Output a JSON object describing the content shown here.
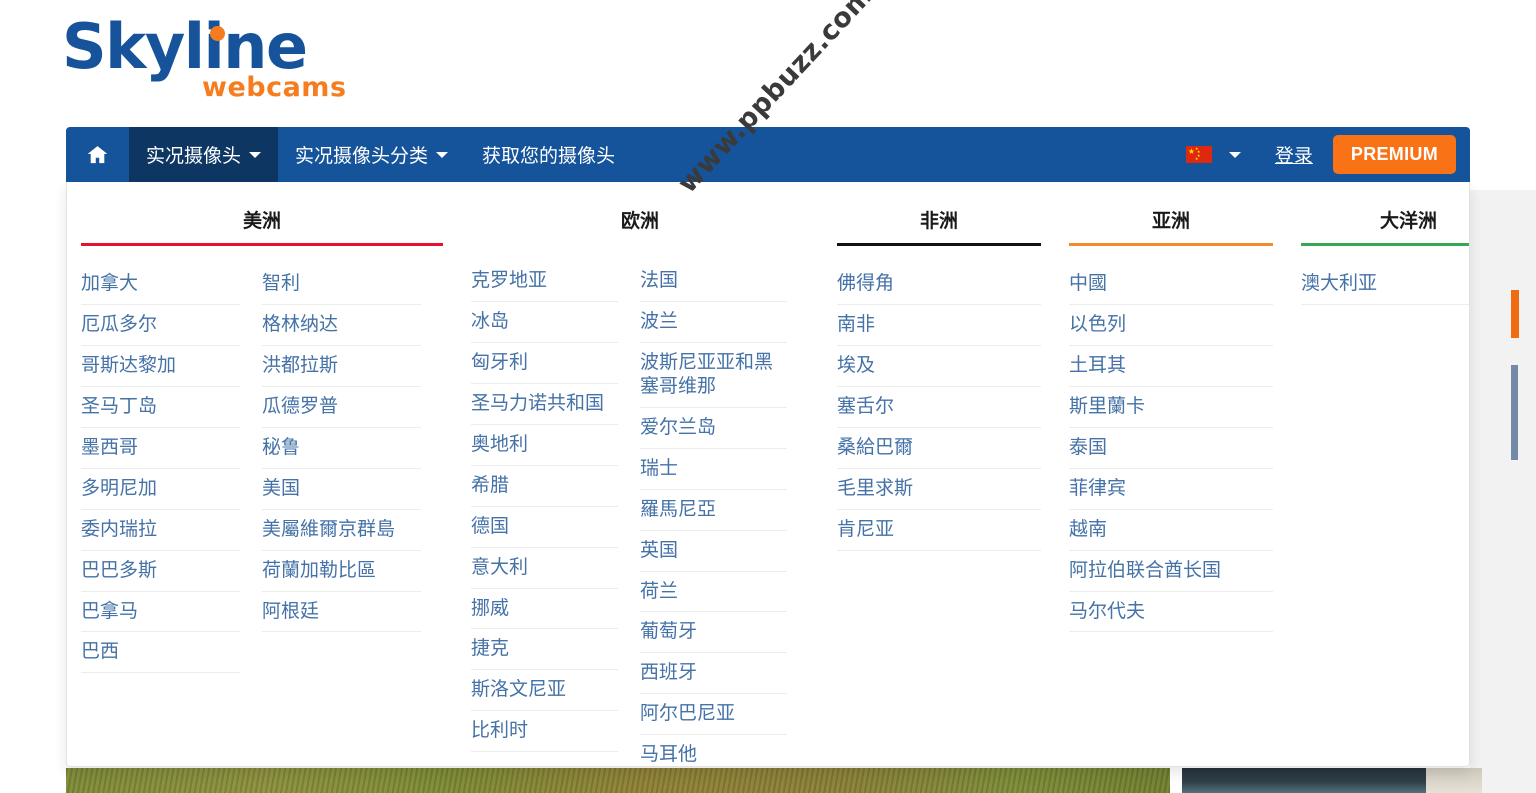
{
  "brand": {
    "name": "Skyline",
    "subtitle": "webcams"
  },
  "navbar": {
    "home_icon": "home-icon",
    "items": [
      {
        "label": "实况摄像头",
        "has_caret": true,
        "active": true
      },
      {
        "label": "实况摄像头分类",
        "has_caret": true,
        "active": false
      },
      {
        "label": "获取您的摄像头",
        "has_caret": false,
        "active": false
      }
    ],
    "language": {
      "flag": "cn-flag-icon",
      "caret": "chevron-down-icon"
    },
    "login_label": "登录",
    "premium_label": "PREMIUM",
    "bg_color": "#15539b",
    "active_bg_color": "#0d3663",
    "premium_color": "#f97316"
  },
  "watermark": "www.ppbuzz.com",
  "dropdown": {
    "regions": [
      {
        "title": "美洲",
        "rule_color": "#e8112d",
        "columns": [
          [
            "加拿大",
            "厄瓜多尔",
            "哥斯达黎加",
            "圣马丁岛",
            "墨西哥",
            "多明尼加",
            "委内瑞拉",
            "巴巴多斯",
            "巴拿马",
            "巴西"
          ],
          [
            "智利",
            "格林纳达",
            "洪都拉斯",
            "瓜德罗普",
            "秘鲁",
            "美国",
            "美屬維爾京群島",
            "荷蘭加勒比區",
            "阿根廷"
          ]
        ]
      },
      {
        "title": "欧洲",
        "rule_color": "#1a8cd8",
        "columns": [
          [
            "克罗地亚",
            "冰岛",
            "匈牙利",
            "圣马力诺共和国",
            "奥地利",
            "希腊",
            "德国",
            "意大利",
            "挪威",
            "捷克",
            "斯洛文尼亚",
            "比利时"
          ],
          [
            "法国",
            "波兰",
            "波斯尼亚亚和黑塞哥维那",
            "爱尔兰岛",
            "瑞士",
            "羅馬尼亞",
            "英国",
            "荷兰",
            "葡萄牙",
            "西班牙",
            "阿尔巴尼亚",
            "马耳他"
          ]
        ]
      },
      {
        "title": "非洲",
        "rule_color": "#111111",
        "columns": [
          [
            "佛得角",
            "南非",
            "埃及",
            "塞舌尔",
            "桑給巴爾",
            "毛里求斯",
            "肯尼亚"
          ]
        ]
      },
      {
        "title": "亚洲",
        "rule_color": "#f28c28",
        "columns": [
          [
            "中國",
            "以色列",
            "土耳其",
            "斯里蘭卡",
            "泰国",
            "菲律宾",
            "越南",
            "阿拉伯联合酋长国",
            "马尔代夫"
          ]
        ]
      },
      {
        "title": "大洋洲",
        "rule_color": "#34a853",
        "columns": [
          [
            "澳大利亚"
          ]
        ]
      }
    ]
  }
}
